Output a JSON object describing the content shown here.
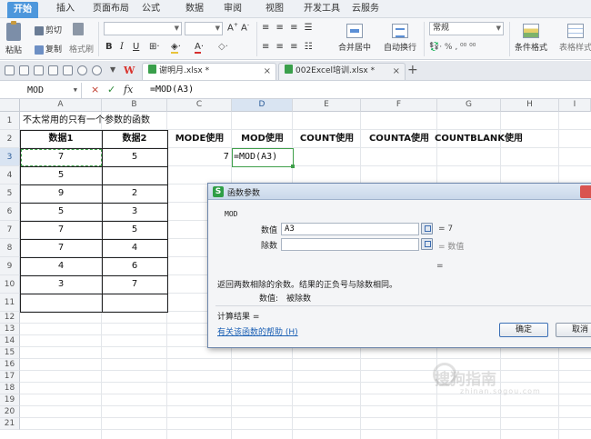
{
  "menu": {
    "tabs": [
      "开始",
      "插入",
      "页面布局",
      "公式",
      "数据",
      "审阅",
      "视图",
      "开发工具",
      "云服务"
    ]
  },
  "ribbon": {
    "paste": "粘贴",
    "cut": "剪切",
    "copy": "复制",
    "format_painter": "格式刷",
    "font_name": "",
    "font_size": "",
    "merge_center": "合并居中",
    "wrap_text": "自动换行",
    "number_format": "常规",
    "conditional_format": "条件格式",
    "table_style": "表格样式"
  },
  "quickbar": {
    "doc_tab_1": "谢明月.xlsx *",
    "doc_tab_2": "002Excel培训.xlsx *",
    "close": "×",
    "add": "+"
  },
  "formula_bar": {
    "name_box": "MOD",
    "cancel": "×",
    "enter": "✓",
    "fx": "fx",
    "formula": "=MOD(A3)"
  },
  "grid": {
    "columns": [
      "A",
      "B",
      "C",
      "D",
      "E",
      "F",
      "G",
      "H",
      "I"
    ],
    "rows": [
      "1",
      "2",
      "3",
      "4",
      "5",
      "6",
      "7",
      "8",
      "9",
      "10",
      "11",
      "12",
      "13",
      "14",
      "15",
      "16",
      "17",
      "18",
      "19",
      "20",
      "21"
    ],
    "title": "不太常用的只有一个参数的函数",
    "headers": [
      "数据1",
      "数据2",
      "MODE使用",
      "MOD使用",
      "COUNT使用",
      "COUNTA使用",
      "COUNTBLANK使用"
    ],
    "data1": [
      "7",
      "5",
      "9",
      "5",
      "7",
      "7",
      "4",
      "3"
    ],
    "data2": [
      "5",
      "",
      "2",
      "3",
      "5",
      "4",
      "6",
      "7"
    ],
    "c3_value": "7",
    "d3_edit": "=MOD(A3)"
  },
  "dialog": {
    "title": "函数参数",
    "function_name": "MOD",
    "arg1_label": "数值",
    "arg1_value": "A3",
    "arg1_result": "= 7",
    "arg2_label": "除数",
    "arg2_value": "",
    "arg2_result": "= 数值",
    "formula_result_eq": "=",
    "description": "返回两数相除的余数。结果的正负号与除数相同。",
    "arg_help_label": "数值:",
    "arg_help_text": "被除数",
    "calc_result": "计算结果 =",
    "help_link": "有关该函数的帮助 (H)",
    "ok": "确定",
    "cancel": "取消"
  },
  "watermark": {
    "text": "搜狗指南",
    "sub": "zhinan.sogou.com"
  }
}
